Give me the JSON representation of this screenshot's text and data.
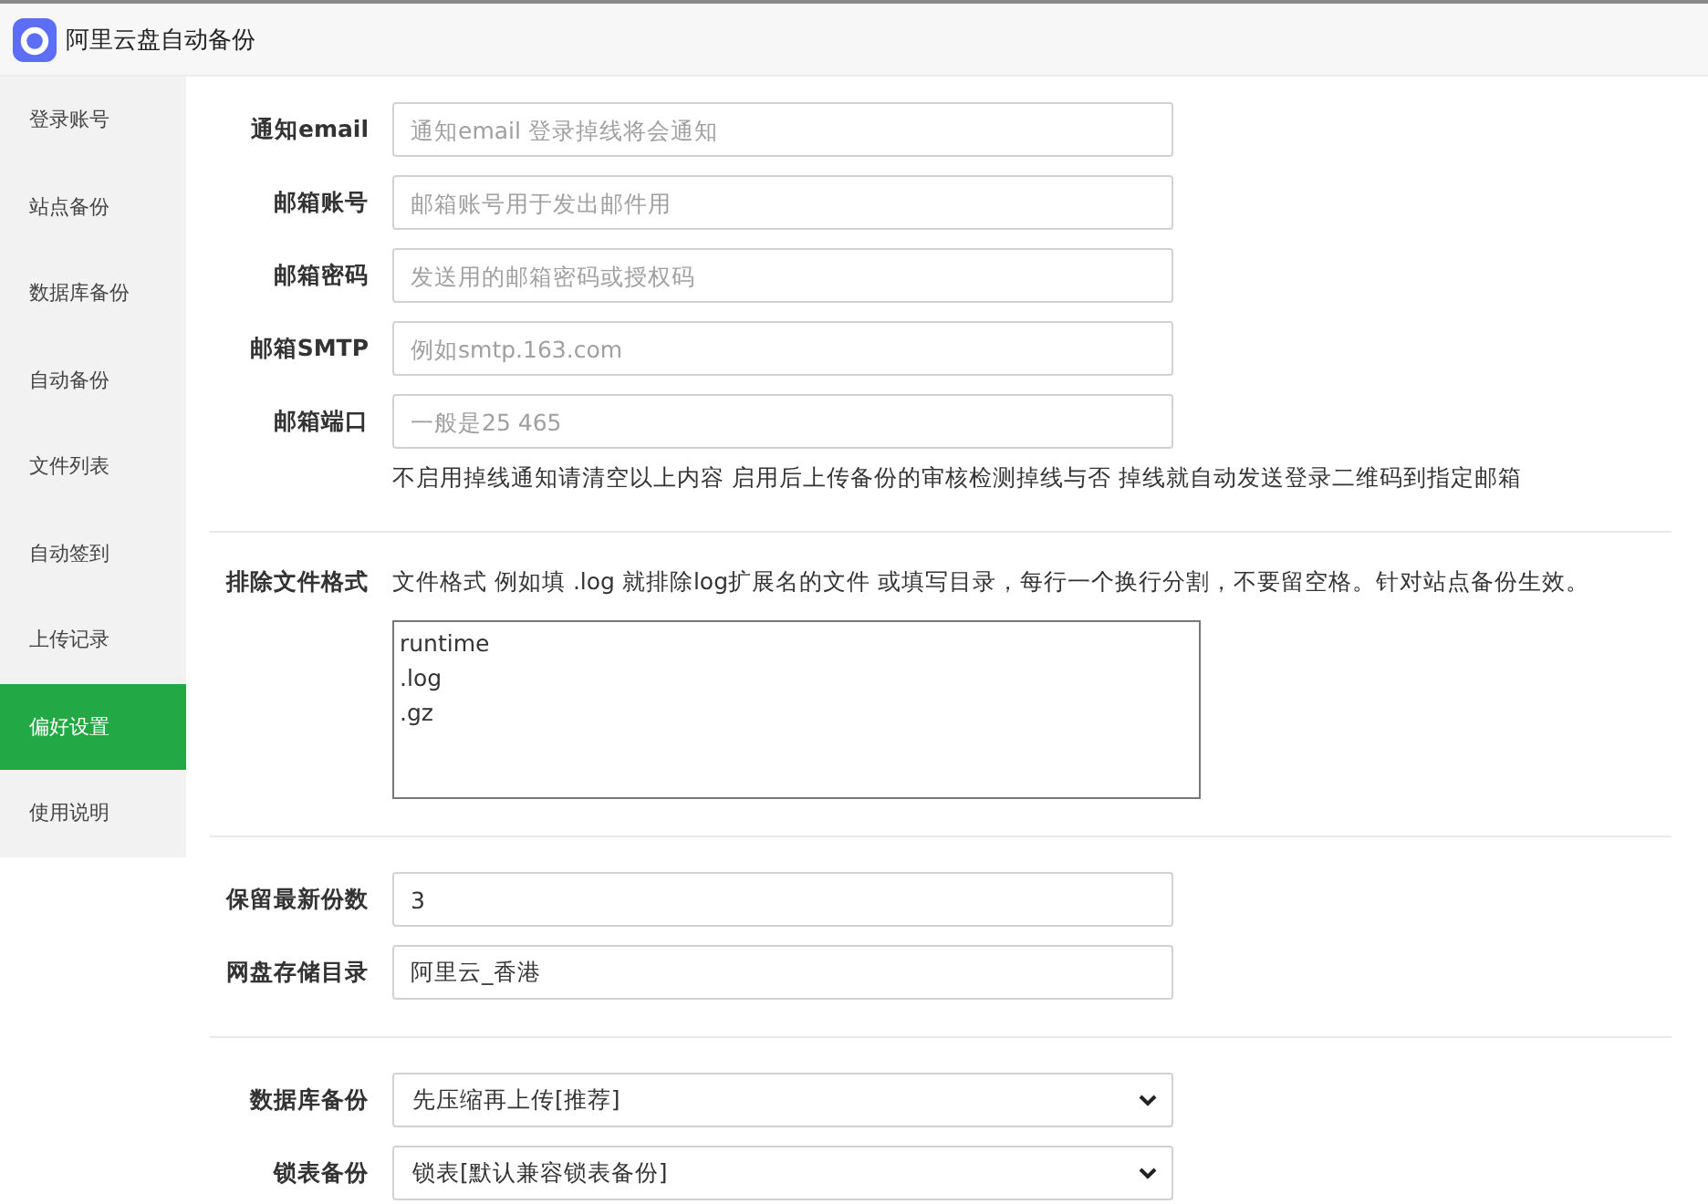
{
  "window": {
    "title": "阿里云盘自动备份"
  },
  "sidebar": {
    "items": [
      {
        "label": "登录账号",
        "selected": false
      },
      {
        "label": "站点备份",
        "selected": false
      },
      {
        "label": "数据库备份",
        "selected": false
      },
      {
        "label": "自动备份",
        "selected": false
      },
      {
        "label": "文件列表",
        "selected": false
      },
      {
        "label": "自动签到",
        "selected": false
      },
      {
        "label": "上传记录",
        "selected": false
      },
      {
        "label": "偏好设置",
        "selected": true
      },
      {
        "label": "使用说明",
        "selected": false
      }
    ]
  },
  "sections": [
    {
      "fields": [
        {
          "kind": "input",
          "label": "通知email",
          "placeholder": "通知email 登录掉线将会通知"
        },
        {
          "kind": "input",
          "label": "邮箱账号",
          "placeholder": "邮箱账号用于发出邮件用"
        },
        {
          "kind": "input",
          "label": "邮箱密码",
          "placeholder": "发送用的邮箱密码或授权码"
        },
        {
          "kind": "input",
          "label": "邮箱SMTP",
          "placeholder": "例如smtp.163.com"
        },
        {
          "kind": "input",
          "label": "邮箱端口",
          "placeholder": "一般是25 465"
        },
        {
          "kind": "note",
          "text": "不启用掉线通知请清空以上内容 启用后上传备份的审核检测掉线与否 掉线就自动发送登录二维码到指定邮箱"
        }
      ]
    },
    {
      "fields": [
        {
          "kind": "textarea",
          "label": "排除文件格式",
          "hint": "文件格式 例如填 .log 就排除log扩展名的文件 或填写目录，每行一个换行分割，不要留空格。针对站点备份生效。",
          "value": "runtime\n.log\n.gz"
        }
      ]
    },
    {
      "fields": [
        {
          "kind": "input",
          "label": "保留最新份数",
          "value": "3"
        },
        {
          "kind": "input",
          "label": "网盘存储目录",
          "value": "阿里云_香港"
        }
      ]
    },
    {
      "fields": [
        {
          "kind": "select",
          "label": "数据库备份",
          "value": "先压缩再上传[推荐]"
        },
        {
          "kind": "select",
          "label": "锁表备份",
          "value": "锁表[默认兼容锁表备份]"
        }
      ]
    }
  ]
}
